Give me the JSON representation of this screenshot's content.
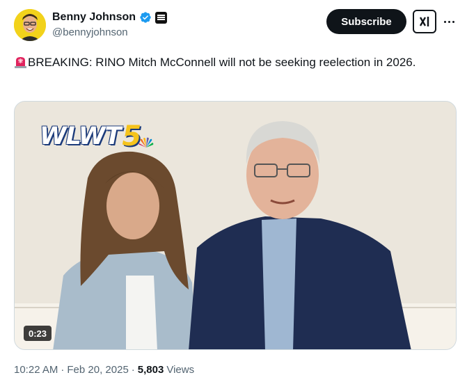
{
  "author": {
    "display_name": "Benny Johnson",
    "handle": "@bennyjohnson",
    "verified_icon": "verified-badge-icon",
    "affiliation_icon": "affiliation-badge-icon"
  },
  "actions": {
    "subscribe_label": "Subscribe",
    "grok_icon": "grok-icon",
    "more_icon": "more-options-icon"
  },
  "tweet": {
    "emoji": "rotating-light-icon",
    "text": "BREAKING: RINO Mitch McConnell will not be seeking reelection in 2026."
  },
  "media": {
    "logo_text": "WLWT",
    "logo_number": "5",
    "duration": "0:23"
  },
  "meta": {
    "time": "10:22 AM",
    "separator": "·",
    "date": "Feb 20, 2025",
    "views_count": "5,803",
    "views_label": "Views"
  },
  "colors": {
    "text_primary": "#0f1419",
    "text_secondary": "#536471",
    "verified_blue": "#1d9bf0",
    "logo_yellow": "#f5c31c"
  }
}
